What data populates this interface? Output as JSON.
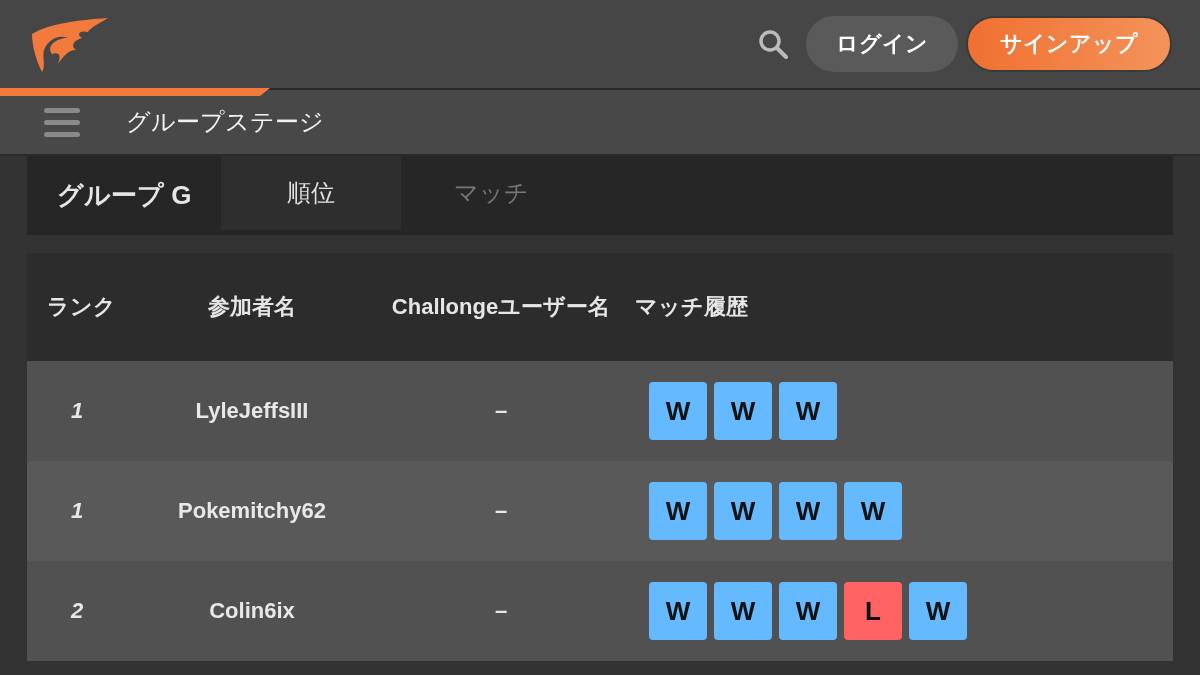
{
  "header": {
    "login": "ログイン",
    "signup": "サインアップ"
  },
  "subheader": {
    "title": "グループステージ"
  },
  "group": {
    "title": "グループ G",
    "tabs": [
      {
        "label": "順位",
        "selected": true
      },
      {
        "label": "マッチ",
        "selected": false
      }
    ]
  },
  "table": {
    "columns": [
      "ランク",
      "参加者名",
      "Challongeユーザー名",
      "マッチ履歴"
    ],
    "rows": [
      {
        "rank": "1",
        "name": "LyleJeffsIII",
        "challonge": "–",
        "history": [
          {
            "kind": "win",
            "label": "W"
          },
          {
            "kind": "win",
            "label": "W"
          },
          {
            "kind": "win",
            "label": "W"
          }
        ]
      },
      {
        "rank": "1",
        "name": "Pokemitchy62",
        "challonge": "–",
        "history": [
          {
            "kind": "win",
            "label": "W"
          },
          {
            "kind": "win",
            "label": "W"
          },
          {
            "kind": "win",
            "label": "W"
          },
          {
            "kind": "win",
            "label": "W"
          }
        ]
      },
      {
        "rank": "2",
        "name": "Colin6ix",
        "challonge": "–",
        "history": [
          {
            "kind": "win",
            "label": "W"
          },
          {
            "kind": "win",
            "label": "W"
          },
          {
            "kind": "win",
            "label": "W"
          },
          {
            "kind": "loss",
            "label": "L"
          },
          {
            "kind": "win",
            "label": "W"
          }
        ]
      }
    ]
  }
}
